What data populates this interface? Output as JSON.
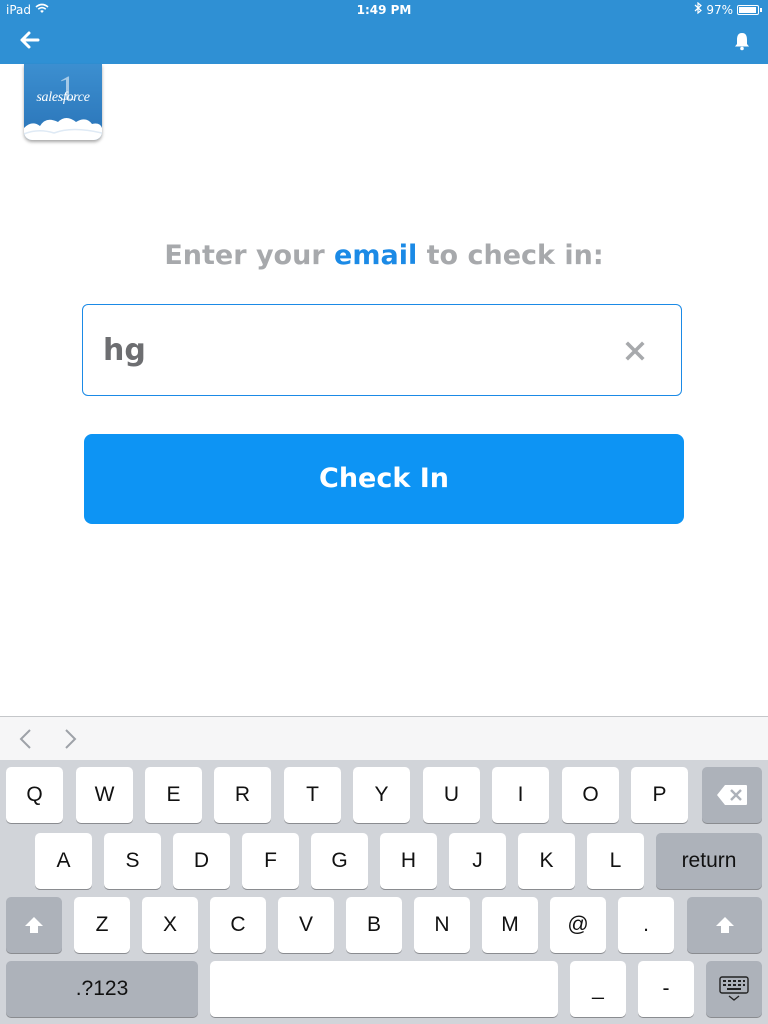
{
  "status_bar": {
    "device": "iPad",
    "time": "1:49 PM",
    "battery": "97%",
    "battery_level": 0.97
  },
  "nav": {
    "back_icon": "back-arrow-icon",
    "bell_icon": "bell-icon"
  },
  "logo": {
    "word": "salesforce",
    "numeral": "1"
  },
  "prompt": {
    "before": "Enter your ",
    "highlight": "email",
    "after": " to check in:"
  },
  "email_field": {
    "value": "hg"
  },
  "check_in_button": {
    "label": "Check In"
  },
  "keyboard": {
    "row1": [
      "Q",
      "W",
      "E",
      "R",
      "T",
      "Y",
      "U",
      "I",
      "O",
      "P"
    ],
    "row2": [
      "A",
      "S",
      "D",
      "F",
      "G",
      "H",
      "J",
      "K",
      "L"
    ],
    "return_label": "return",
    "row3": [
      "Z",
      "X",
      "C",
      "V",
      "B",
      "N",
      "M",
      "@",
      "."
    ],
    "numbers_label": ".?123",
    "underscore_label": "_",
    "dash_label": "-"
  },
  "colors": {
    "nav_blue": "#2f90d4",
    "accent_blue": "#1b8ae6",
    "button_blue": "#0d94f4",
    "prompt_gray": "#a7a9ac",
    "keyboard_bg": "#d1d4d9"
  }
}
